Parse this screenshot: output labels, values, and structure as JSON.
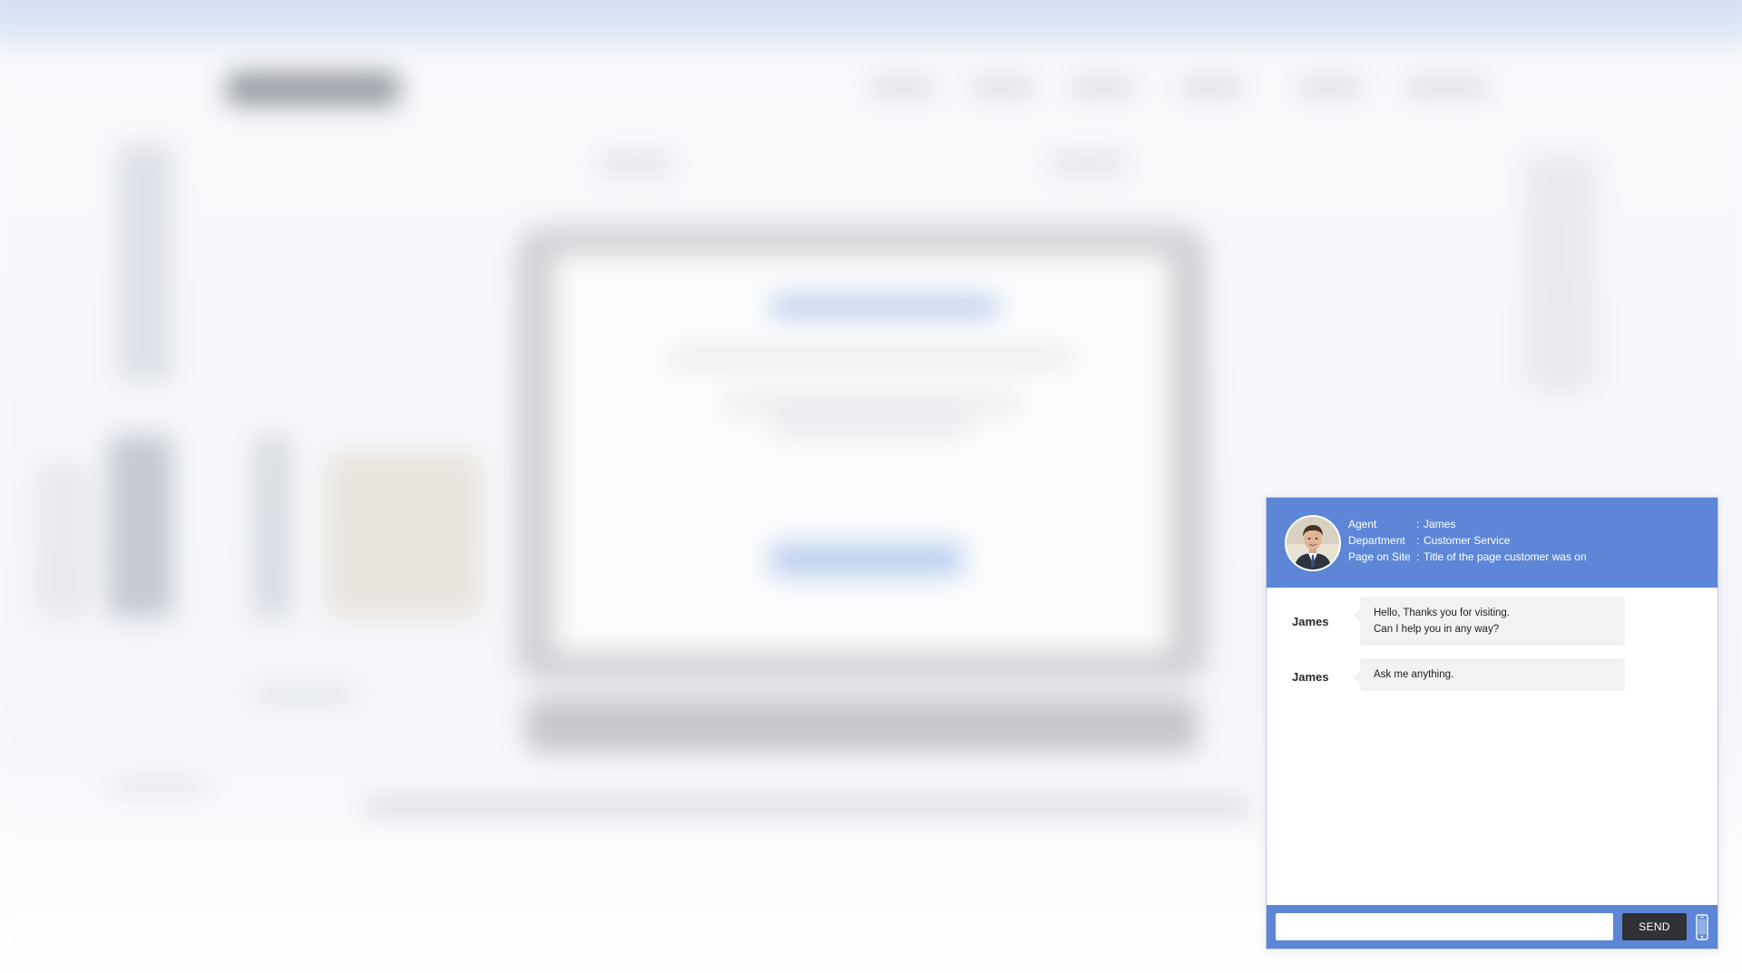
{
  "agent_panel": {
    "rows": [
      {
        "label": "Agent",
        "value": "James"
      },
      {
        "label": "Department",
        "value": "Customer Service"
      },
      {
        "label": "Page on Site",
        "value": "Title of the page customer was on"
      }
    ],
    "separator": ":"
  },
  "messages": [
    {
      "sender": "James",
      "lines": [
        "Hello, Thanks you for visiting.",
        "Can I help you in any way?"
      ]
    },
    {
      "sender": "James",
      "lines": [
        "Ask me anything."
      ]
    }
  ],
  "composer": {
    "input_value": "",
    "send_label": "SEND",
    "mobile_icon": "phone-icon"
  },
  "colors": {
    "accent": "#5d87d6",
    "send_button": "#2f3136",
    "bubble": "#f2f2f2"
  }
}
